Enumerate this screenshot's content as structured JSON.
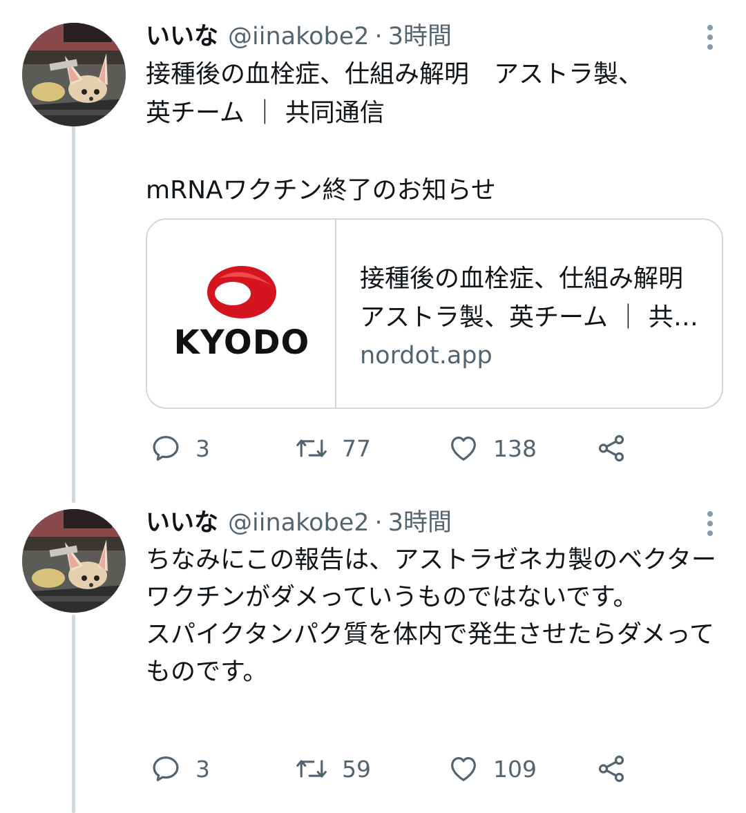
{
  "tweets": [
    {
      "author": {
        "name": "いいな",
        "handle": "@iinakobe2",
        "separator": "·",
        "time": "3時間"
      },
      "text": "接種後の血栓症、仕組み解明　アストラ製、\n英チーム ｜ 共同通信\n\nmRNAワクチン終了のお知らせ",
      "card": {
        "logo_text": "KYODO",
        "title": "接種後の血栓症、仕組み解明　アストラ製、英チーム ｜ 共同通信",
        "domain": "nordot.app"
      },
      "stats": {
        "replies": "3",
        "retweets": "77",
        "likes": "138"
      }
    },
    {
      "author": {
        "name": "いいな",
        "handle": "@iinakobe2",
        "separator": "·",
        "time": "3時間"
      },
      "text": "ちなみにこの報告は、アストラゼネカ製のベクターワクチンがダメっていうものではないです。\nスパイクタンパク質を体内で発生させたらダメってものです。",
      "stats": {
        "replies": "3",
        "retweets": "59",
        "likes": "109"
      }
    }
  ],
  "icons": {
    "reply": "reply-icon",
    "retweet": "retweet-icon",
    "like": "heart-icon",
    "share": "share-icon",
    "more": "more-vertical-icon"
  },
  "colors": {
    "text": "#0f1419",
    "secondary": "#536471",
    "border": "#cfd9de",
    "kyodo_red": "#d4141e"
  }
}
